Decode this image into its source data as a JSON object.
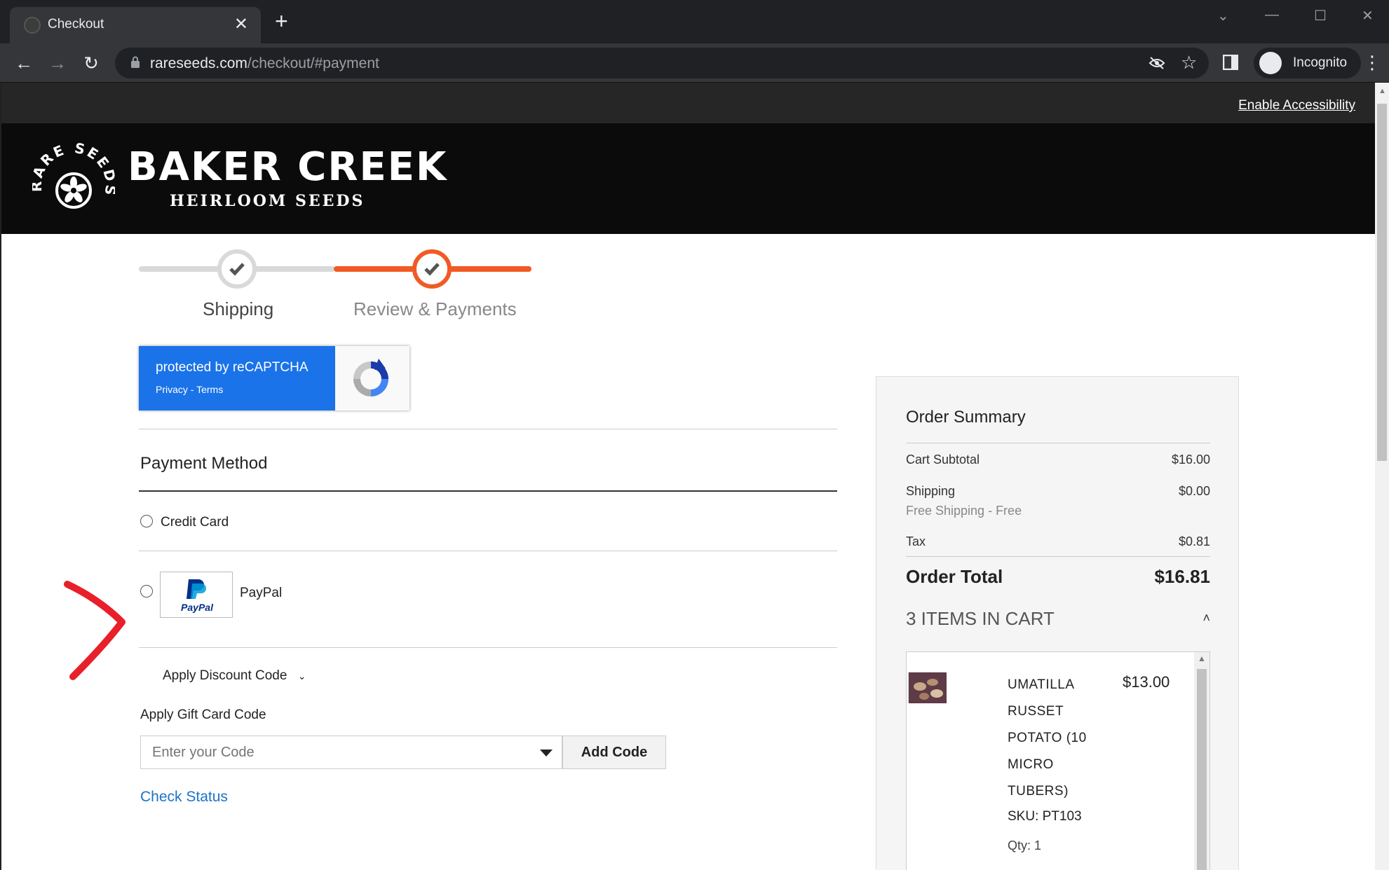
{
  "browser": {
    "tab_title": "Checkout",
    "url_host": "rareseeds.com",
    "url_path": "/checkout/#payment",
    "profile_label": "Incognito"
  },
  "site": {
    "accessibility_link": "Enable Accessibility",
    "brand_name": "BAKER CREEK",
    "brand_sub": "HEIRLOOM SEEDS",
    "emblem_text": "RARE SEEDS"
  },
  "steps": [
    {
      "label": "Shipping",
      "state": "complete"
    },
    {
      "label": "Review & Payments",
      "state": "active"
    }
  ],
  "recaptcha": {
    "line1": "protected by reCAPTCHA",
    "line2": "Privacy - Terms"
  },
  "payment": {
    "title": "Payment Method",
    "options": [
      {
        "label": "Credit Card",
        "selected": false
      },
      {
        "label": "PayPal",
        "selected": false
      }
    ],
    "paypal_logo_text": "PayPal"
  },
  "discount": {
    "label": "Apply Discount Code"
  },
  "gift_card": {
    "label": "Apply Gift Card Code",
    "placeholder": "Enter your Code",
    "button": "Add Code",
    "check_status": "Check Status"
  },
  "summary": {
    "title": "Order Summary",
    "subtotal_label": "Cart Subtotal",
    "subtotal_value": "$16.00",
    "shipping_label": "Shipping",
    "shipping_value": "$0.00",
    "shipping_method": "Free Shipping - Free",
    "tax_label": "Tax",
    "tax_value": "$0.81",
    "total_label": "Order Total",
    "total_value": "$16.81",
    "items_header": "3 ITEMS IN CART",
    "items": [
      {
        "name": "UMATILLA RUSSET POTATO (10 MICRO TUBERS)",
        "price": "$13.00",
        "sku": "SKU: PT103",
        "qty": "Qty: 1"
      }
    ]
  },
  "colors": {
    "accent": "#f15a24",
    "step_gray": "#d9d9d9",
    "link": "#1a73c8",
    "annotation": "#e8202a"
  }
}
